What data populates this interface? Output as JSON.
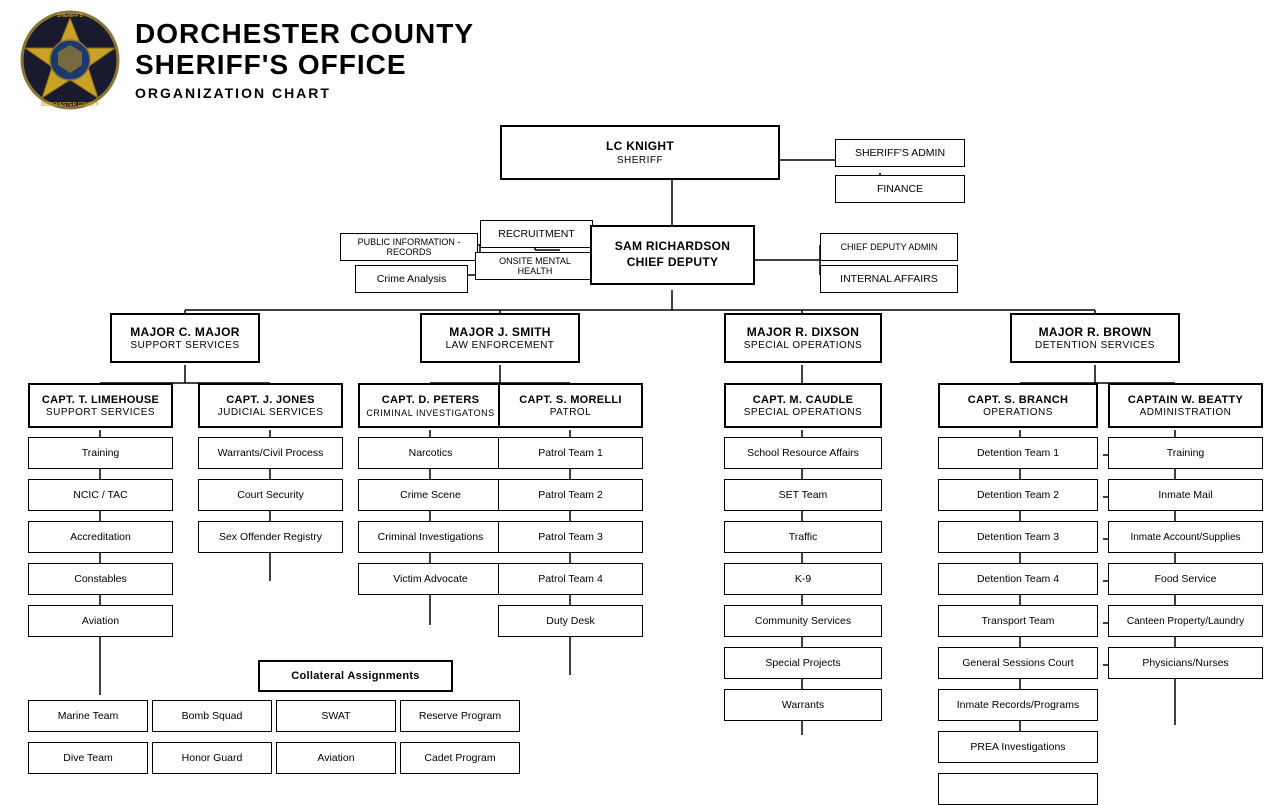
{
  "header": {
    "org_name_line1": "DORCHESTER COUNTY",
    "org_name_line2": "SHERIFF'S OFFICE",
    "chart_label": "ORGANIZATION CHART"
  },
  "sheriff": {
    "name": "LC KNIGHT",
    "title": "SHERIFF"
  },
  "sheriff_right": {
    "admin": "SHERIFF'S ADMIN",
    "finance": "FINANCE"
  },
  "chief_deputy_left": [
    {
      "label": "PUBLIC INFORMATION - RECORDS"
    },
    {
      "label": "Crime Analysis"
    }
  ],
  "chief_deputy_mid_top": [
    {
      "label": "RECRUITMENT"
    },
    {
      "label": "ONSITE MENTAL HEALTH"
    }
  ],
  "chief_deputy": {
    "name": "SAM RICHARDSON",
    "title": "CHIEF DEPUTY"
  },
  "chief_deputy_right": [
    {
      "label": "CHIEF DEPUTY ADMIN"
    },
    {
      "label": "INTERNAL AFFAIRS"
    }
  ],
  "majors": [
    {
      "name": "MAJOR C. MAJOR",
      "title": "SUPPORT SERVICES",
      "captains": [
        {
          "name": "CAPT. T. LIMEHOUSE",
          "title": "SUPPORT SERVICES",
          "units": [
            "Training",
            "NCIC / TAC",
            "Accreditation",
            "Constables",
            "Aviation"
          ]
        },
        {
          "name": "CAPT. J. JONES",
          "title": "JUDICIAL SERVICES",
          "units": [
            "Warrants/Civil Process",
            "Court Security",
            "Sex Offender Registry"
          ]
        }
      ]
    },
    {
      "name": "MAJOR J. SMITH",
      "title": "LAW ENFORCEMENT",
      "captains": [
        {
          "name": "CAPT. D. PETERS",
          "title": "CRIMINAL INVESTIGATONS",
          "units": [
            "Narcotics",
            "Crime Scene",
            "Criminal Investigations",
            "Victim Advocate"
          ]
        },
        {
          "name": "CAPT. S. MORELLI",
          "title": "PATROL",
          "units": [
            "Patrol Team 1",
            "Patrol Team 2",
            "Patrol Team 3",
            "Patrol Team 4",
            "Duty Desk"
          ]
        }
      ],
      "collateral": {
        "label": "Collateral Assignments",
        "rows": [
          [
            "Marine Team",
            "Bomb Squad",
            "SWAT",
            "Reserve Program"
          ],
          [
            "Dive Team",
            "Honor Guard",
            "Aviation",
            "Cadet Program"
          ]
        ]
      }
    },
    {
      "name": "MAJOR R. DIXSON",
      "title": "SPECIAL OPERATIONS",
      "captains": [
        {
          "name": "CAPT. M. CAUDLE",
          "title": "SPECIAL OPERATIONS",
          "units": [
            "School Resource Affairs",
            "SET Team",
            "Traffic",
            "K-9",
            "Community Services",
            "Special Projects",
            "Warrants"
          ]
        }
      ]
    },
    {
      "name": "MAJOR R. BROWN",
      "title": "DETENTION SERVICES",
      "captains": [
        {
          "name": "CAPT. S. BRANCH",
          "title": "OPERATIONS",
          "units": [
            "Detention Team 1",
            "Detention Team 2",
            "Detention Team 3",
            "Detention Team 4",
            "Transport Team",
            "General Sessions Court",
            "Inmate Records/Programs",
            "PREA Investigations"
          ]
        },
        {
          "name": "CAPTAIN W. BEATTY",
          "title": "ADMINISTRATION",
          "units": [
            "Training",
            "Inmate Mail",
            "Inmate Account/Supplies",
            "Food Service",
            "Canteen Property/Laundry",
            "Physicians/Nurses"
          ]
        }
      ]
    }
  ]
}
